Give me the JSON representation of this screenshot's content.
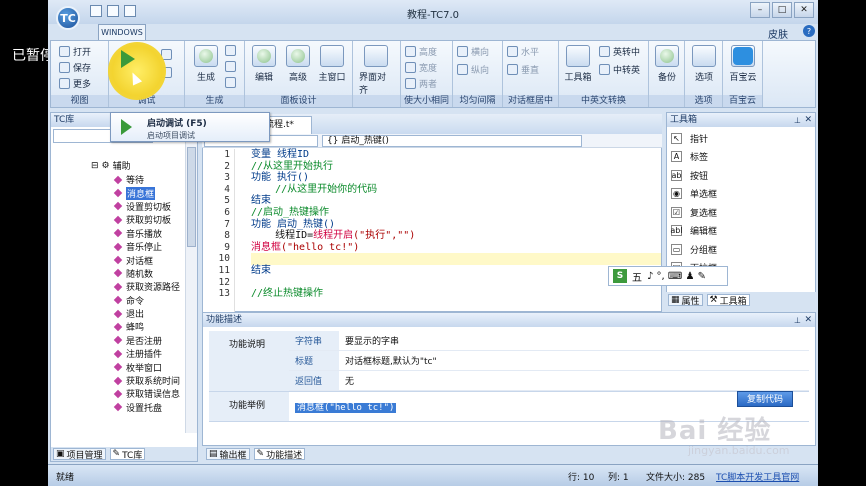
{
  "overlay": {
    "paused": "已暂停"
  },
  "titlebar": {
    "title": "教程-TC7.0",
    "logo": "TC"
  },
  "tabs": {
    "windows": "WINDOWS",
    "skin": "皮肤",
    "help": "?"
  },
  "ribbon": {
    "groups": [
      {
        "label": "视图",
        "items": [
          "打开",
          "保存",
          "更多"
        ]
      },
      {
        "label": "调试",
        "items": [
          "运行"
        ]
      },
      {
        "label": "生成",
        "items": [
          "生成"
        ]
      },
      {
        "label": "面板设计",
        "items": [
          "编辑",
          "高级",
          "主窗口"
        ]
      },
      {
        "label": "",
        "items": [
          "界面对齐"
        ]
      },
      {
        "label": "使大小相同",
        "items": [
          "高度",
          "宽度",
          "两者"
        ]
      },
      {
        "label": "均匀间隔",
        "items": [
          "横向",
          "纵向"
        ]
      },
      {
        "label": "对话框居中",
        "items": [
          "水平",
          "垂直"
        ]
      },
      {
        "label": "中英文转换",
        "items": [
          "工具箱",
          "英转中",
          "中转英"
        ]
      },
      {
        "label": "",
        "items": [
          "备份"
        ]
      },
      {
        "label": "选项",
        "items": [
          "选项"
        ]
      },
      {
        "label": "百宝云",
        "items": [
          "百宝云"
        ]
      }
    ]
  },
  "tooltip": {
    "title": "启动调试 (F5)",
    "desc": "启动项目调试"
  },
  "leftpanel": {
    "header": "TC库",
    "root": "辅助",
    "items": [
      "等待",
      "消息框",
      "设置剪切板",
      "获取剪切板",
      "音乐播放",
      "音乐停止",
      "对话框",
      "随机数",
      "获取资源路径",
      "命令",
      "退出",
      "蜂鸣",
      "是否注册",
      "注册插件",
      "枚举窗口",
      "获取系统时间",
      "获取错误信息",
      "设置托盘"
    ],
    "selected_index": 1,
    "tabs": [
      "项目管理",
      "TC库"
    ]
  },
  "editor": {
    "tab": "流程.t*",
    "combo2": "{} 启动_热键()",
    "lines": [
      {
        "n": "1",
        "parts": [
          {
            "c": "c-kw",
            "t": "变量 线程ID"
          }
        ]
      },
      {
        "n": "2",
        "parts": [
          {
            "c": "c-cm",
            "t": "//从这里开始执行"
          }
        ]
      },
      {
        "n": "3",
        "parts": [
          {
            "c": "c-kw",
            "t": "功能 执行()"
          }
        ]
      },
      {
        "n": "4",
        "parts": [
          {
            "c": "c-cm",
            "t": "    //从这里开始你的代码"
          }
        ]
      },
      {
        "n": "5",
        "parts": [
          {
            "c": "c-kw",
            "t": "结束"
          }
        ]
      },
      {
        "n": "6",
        "parts": [
          {
            "c": "c-cm",
            "t": "//启动_热键操作"
          }
        ]
      },
      {
        "n": "7",
        "parts": [
          {
            "c": "c-kw",
            "t": "功能 启动_热键()"
          }
        ]
      },
      {
        "n": "8",
        "parts": [
          {
            "c": "c-def",
            "t": "    线程ID="
          },
          {
            "c": "c-red",
            "t": "线程开启"
          },
          {
            "c": "c-str",
            "t": "(\"执行\",\"\")"
          }
        ]
      },
      {
        "n": "9",
        "parts": [
          {
            "c": "c-red",
            "t": "消息框"
          },
          {
            "c": "c-str",
            "t": "(\"hello tc!\")"
          }
        ]
      },
      {
        "n": "10",
        "parts": [
          {
            "c": "c-def",
            "t": ""
          }
        ]
      },
      {
        "n": "11",
        "parts": [
          {
            "c": "c-kw",
            "t": "结束"
          }
        ]
      },
      {
        "n": "12",
        "parts": [
          {
            "c": "c-def",
            "t": ""
          }
        ]
      },
      {
        "n": "13",
        "parts": [
          {
            "c": "c-cm",
            "t": "//终止热键操作"
          }
        ]
      }
    ]
  },
  "toolbox": {
    "header": "工具箱",
    "items": [
      {
        "icon": "↖",
        "label": "指针"
      },
      {
        "icon": "A",
        "label": "标签"
      },
      {
        "icon": "ab",
        "label": "按钮"
      },
      {
        "icon": "◉",
        "label": "单选框"
      },
      {
        "icon": "☑",
        "label": "复选框"
      },
      {
        "icon": "abl",
        "label": "编辑框"
      },
      {
        "icon": "▭",
        "label": "分组框"
      },
      {
        "icon": "▤",
        "label": "下拉框"
      }
    ],
    "tabs": [
      "属性",
      "工具箱"
    ]
  },
  "ime": {
    "logo": "S",
    "mode": "五",
    "symbols": "♪ °, ⌨ ♟ ✎"
  },
  "funcpanel": {
    "header": "功能描述",
    "desc_label": "功能说明",
    "rows": [
      {
        "key": "字符串",
        "val": "要显示的字串"
      },
      {
        "key": "标题",
        "val": "对话框标题,默认为\"tc\""
      },
      {
        "key": "返回值",
        "val": "无"
      }
    ],
    "example_label": "功能举例",
    "example_code": "消息框(\"hello tc!\")",
    "copy_button": "复制代码",
    "tabs": [
      "输出框",
      "功能描述"
    ]
  },
  "status": {
    "ready": "就绪",
    "row": "行: 10",
    "col": "列: 1",
    "filesize": "文件大小: 285",
    "link": "TC脚本开发工具官网"
  },
  "watermark": {
    "main": "Bai 经验",
    "sub": "jingyan.baidu.com"
  }
}
